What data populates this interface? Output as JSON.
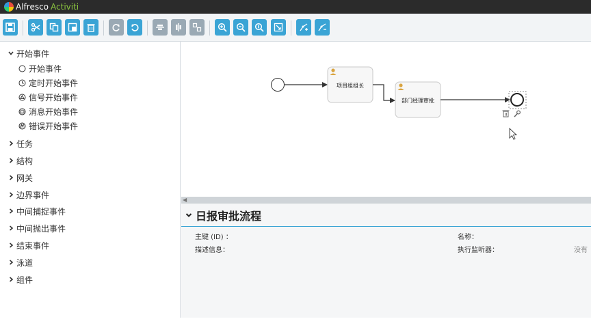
{
  "app": {
    "brand": "Alfresco",
    "product": "Activiti"
  },
  "colors": {
    "accent": "#3aa4d5",
    "topbar": "#2b2b2b",
    "brand_green": "#8cc63f"
  },
  "toolbar": {
    "buttons": [
      "save-icon",
      "cut-icon",
      "copy-icon",
      "paste-icon",
      "delete-icon",
      "redo-icon",
      "undo-icon",
      "align-horizontal-icon",
      "align-vertical-icon",
      "same-size-icon",
      "zoom-in-icon",
      "zoom-out-icon",
      "zoom-actual-icon",
      "zoom-fit-icon",
      "add-bendpoint-icon",
      "remove-bendpoint-icon"
    ]
  },
  "sidebar": {
    "expanded_group": "开始事件",
    "start_events": [
      "开始事件",
      "定时开始事件",
      "信号开始事件",
      "消息开始事件",
      "错误开始事件"
    ],
    "groups": [
      "任务",
      "结构",
      "网关",
      "边界事件",
      "中间捕捉事件",
      "中间抛出事件",
      "结束事件",
      "泳道",
      "组件"
    ]
  },
  "diagram": {
    "task1": "项目组组长",
    "task2": "部门经理审批"
  },
  "properties": {
    "title": "日报审批流程",
    "id_label": "主键 (ID) ：",
    "desc_label": "描述信息：",
    "name_label": "名称：",
    "listener_label": "执行监听器：",
    "listener_value": "没有"
  }
}
